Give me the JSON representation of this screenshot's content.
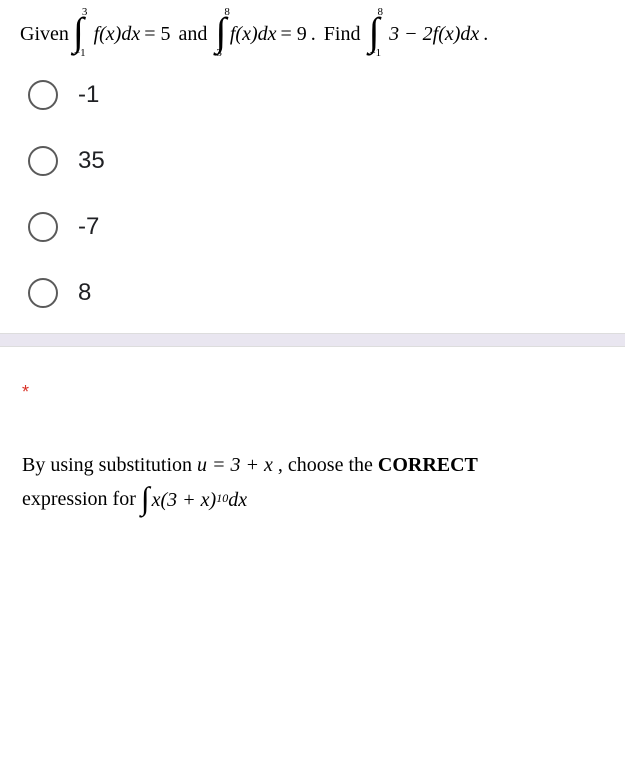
{
  "question1": {
    "prefix": "Given",
    "integral1": {
      "upper": "3",
      "lower": "−1",
      "body": "f(x)dx",
      "equals": "= 5"
    },
    "connector1": "and",
    "integral2": {
      "upper": "8",
      "lower": "3",
      "body": "f(x)dx",
      "equals": "= 9"
    },
    "period1": ".",
    "connector2": "Find",
    "integral3": {
      "upper": "8",
      "lower": "−1",
      "body": "3 − 2f(x)dx",
      "equals": ""
    },
    "period2": ".",
    "options": [
      "-1",
      "35",
      "-7",
      "8"
    ]
  },
  "question2": {
    "required": "*",
    "line1_part1": "By using substitution ",
    "line1_sub": "u = 3 + x",
    "line1_part2": " , choose the ",
    "line1_bold": "CORRECT",
    "line2_part1": "expression for ",
    "integral_body": "x(3 + x)",
    "integral_power": "10",
    "integral_dx": " dx"
  }
}
